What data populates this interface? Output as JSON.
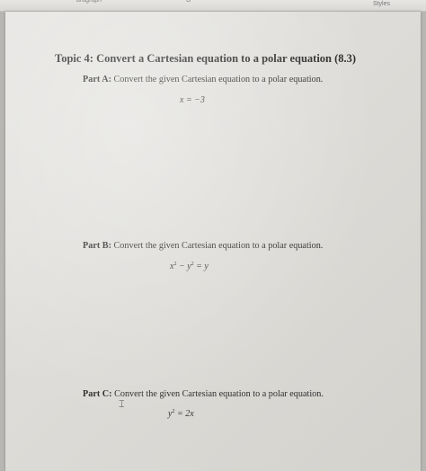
{
  "toolbar": {
    "styles_label": "Styles",
    "frag_left": "aragraph",
    "frag_mid": "G"
  },
  "document": {
    "title": "Topic 4:  Convert a Cartesian equation to a polar equation (8.3)",
    "parts": [
      {
        "label": "Part A:",
        "text": " Convert the given Cartesian equation to a polar equation.",
        "equation": "x = −3"
      },
      {
        "label": "Part B:",
        "text": " Convert the given Cartesian equation to a polar equation.",
        "equation_lhs_a": "x",
        "equation_sup_a": "2",
        "equation_mid": " − y",
        "equation_sup_b": "2",
        "equation_rhs": " = y"
      },
      {
        "label": "Part C:",
        "text": " Convert the given Cartesian equation to a polar equation.",
        "equation_lhs": "y",
        "equation_sup": "2",
        "equation_rhs": " = 2x"
      }
    ]
  }
}
